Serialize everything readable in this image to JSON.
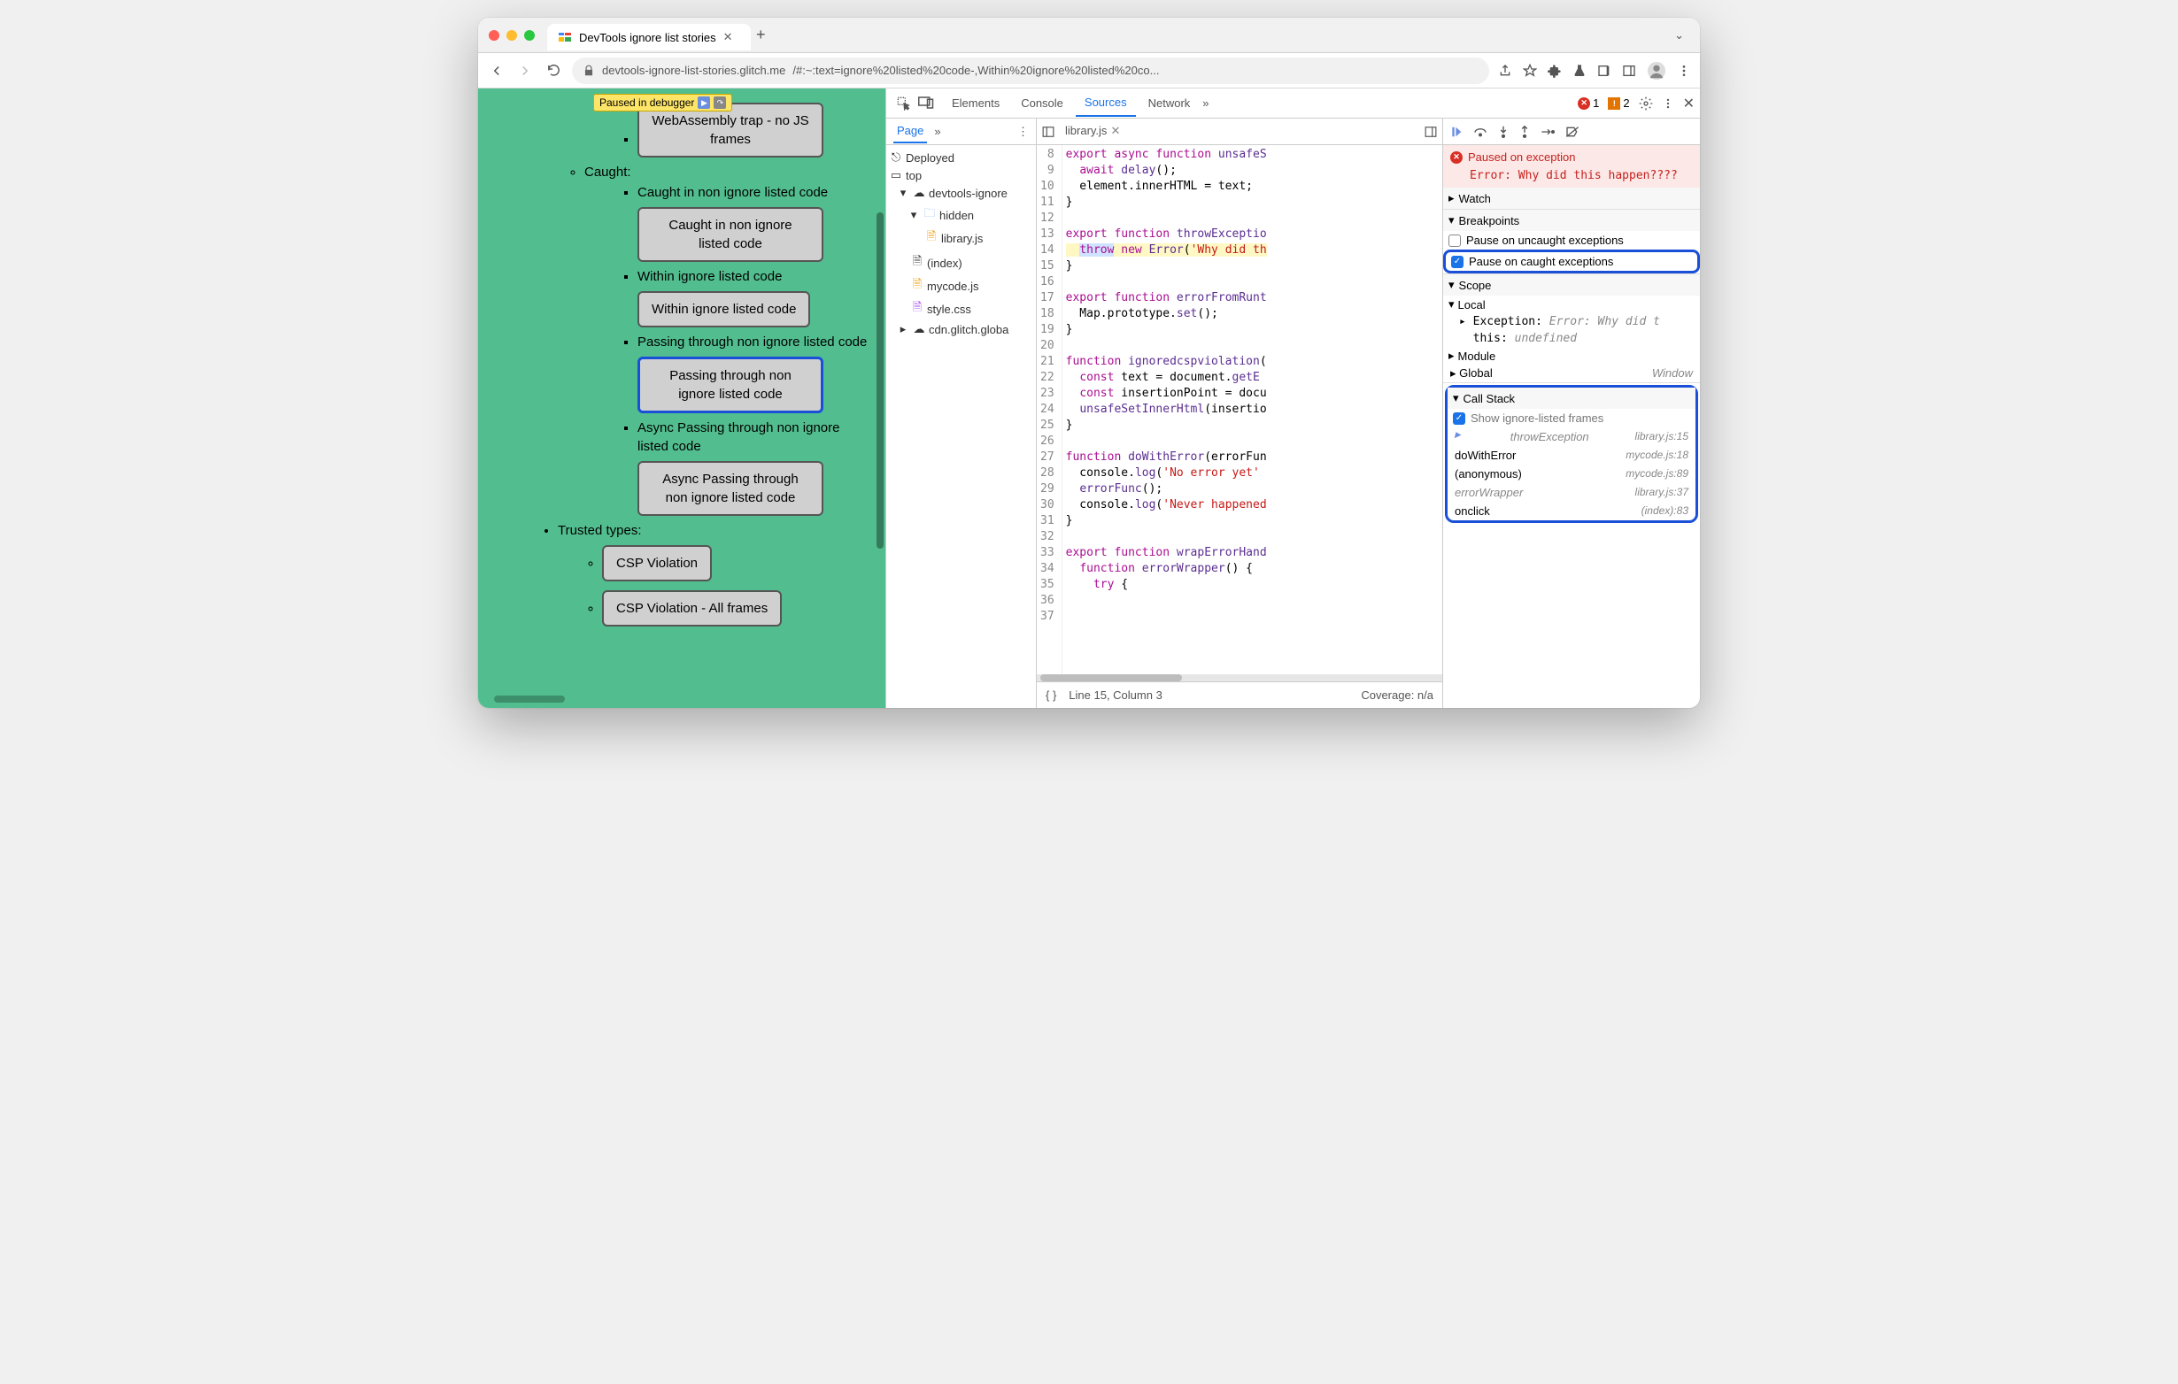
{
  "browser": {
    "tab_title": "DevTools ignore list stories",
    "url_host": "devtools-ignore-list-stories.glitch.me",
    "url_path": "/#:~:text=ignore%20listed%20code-,Within%20ignore%20listed%20co...",
    "paused_label": "Paused in debugger"
  },
  "page": {
    "wasm_btn": "WebAssembly trap - no JS frames",
    "caught_hdr": "Caught:",
    "caught_non_ignore_text": "Caught in non ignore listed code",
    "caught_non_ignore_btn": "Caught in non ignore listed code",
    "within_text": "Within ignore listed code",
    "within_btn": "Within ignore listed code",
    "passing_text": "Passing through non ignore listed code",
    "passing_btn": "Passing through non ignore listed code",
    "async_text": "Async Passing through non ignore listed code",
    "async_btn": "Async Passing through non ignore listed code",
    "trusted_hdr": "Trusted types:",
    "csp_btn": "CSP Violation",
    "csp_all_btn": "CSP Violation - All frames"
  },
  "devtools": {
    "tabs": {
      "elements": "Elements",
      "console": "Console",
      "sources": "Sources",
      "network": "Network"
    },
    "errors": "1",
    "issues": "2",
    "page_tab": "Page",
    "tree": {
      "deployed": "Deployed",
      "top": "top",
      "app": "devtools-ignore",
      "hidden": "hidden",
      "library": "library.js",
      "index": "(index)",
      "mycode": "mycode.js",
      "style": "style.css",
      "cdn": "cdn.glitch.globa"
    },
    "editor_tab": "library.js",
    "status_line": "Line 15, Column 3",
    "coverage": "Coverage: n/a"
  },
  "code": {
    "l8": "export async function unsafeS",
    "l9": "  await delay();",
    "l10": "  element.innerHTML = text;",
    "l11": "}",
    "l12": "",
    "l14": "export function throwExceptio",
    "l15a": "throw",
    "l15b": " new Error('Why did th",
    "l16": "}",
    "l17": "",
    "l18": "export function errorFromRunt",
    "l19": "  Map.prototype.set();",
    "l20": "}",
    "l21": "",
    "l22": "function ignoredcspviolation(",
    "l23": "  const text = document.getE",
    "l24": "  const insertionPoint = docu",
    "l25": "  unsafeSetInnerHtml(insertio",
    "l26": "}",
    "l27": "",
    "l28": "function doWithError(errorFun",
    "l29": "  console.log('No error yet'",
    "l30": "  errorFunc();",
    "l31": "  console.log('Never happened",
    "l32": "}",
    "l33": "",
    "l34": "export function wrapErrorHand",
    "l35": "  function errorWrapper() {",
    "l36": "    try {"
  },
  "debugger": {
    "paused_title": "Paused on exception",
    "paused_msg": "Error: Why did this happen????",
    "watch": "Watch",
    "breakpoints": "Breakpoints",
    "pause_uncaught": "Pause on uncaught exceptions",
    "pause_caught": "Pause on caught exceptions",
    "scope": "Scope",
    "local": "Local",
    "exception_label": "Exception",
    "exception_val": "Error: Why did t",
    "this_label": "this",
    "this_val": "undefined",
    "module": "Module",
    "global": "Global",
    "global_val": "Window",
    "callstack": "Call Stack",
    "show_ignored": "Show ignore-listed frames",
    "stack": [
      {
        "name": "throwException",
        "loc": "library.js:15",
        "ignored": true,
        "current": true
      },
      {
        "name": "doWithError",
        "loc": "mycode.js:18",
        "ignored": false
      },
      {
        "name": "(anonymous)",
        "loc": "mycode.js:89",
        "ignored": false
      },
      {
        "name": "errorWrapper",
        "loc": "library.js:37",
        "ignored": true
      },
      {
        "name": "onclick",
        "loc": "(index):83",
        "ignored": false
      }
    ]
  }
}
